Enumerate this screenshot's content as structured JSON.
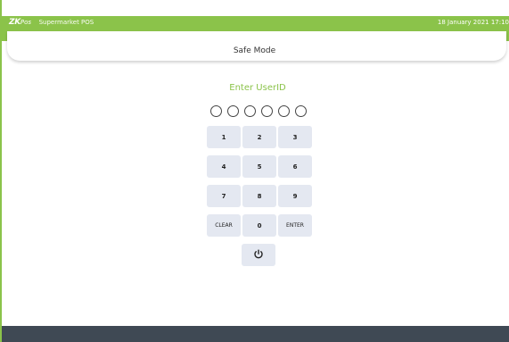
{
  "topbar": {
    "logo_primary": "ZK",
    "logo_secondary": "Pos",
    "app_name": "Supermarket POS",
    "datetime": "18 January 2021 17:10"
  },
  "header": {
    "title": "Safe Mode"
  },
  "prompt": {
    "title": "Enter UserID"
  },
  "keypad": {
    "rows": [
      [
        "1",
        "2",
        "3"
      ],
      [
        "4",
        "5",
        "6"
      ],
      [
        "7",
        "8",
        "9"
      ],
      [
        "CLEAR",
        "0",
        "ENTER"
      ]
    ],
    "power_icon": "power-icon"
  },
  "colors": {
    "brand": "#8bc34a",
    "key_bg": "#e4e8f1",
    "footer": "#3f4954"
  }
}
